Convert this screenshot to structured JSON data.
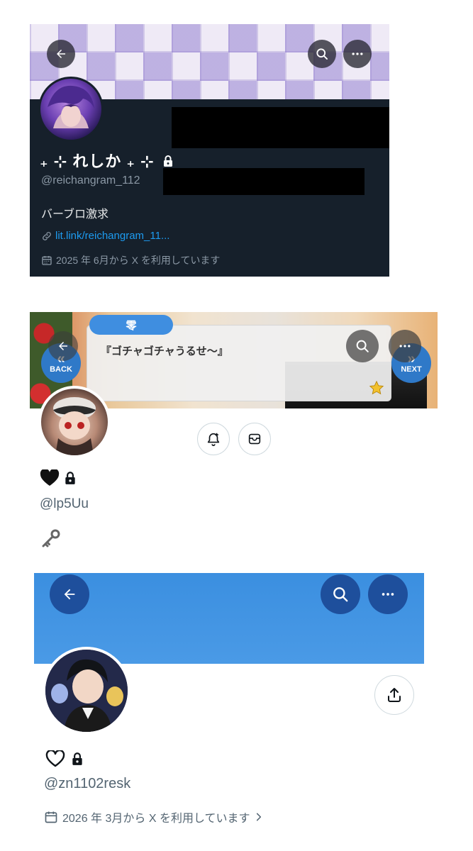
{
  "profile1": {
    "display_name": "₊ ⊹ れしか ₊ ⊹",
    "handle": "@reichangram_112",
    "bio": "バーブロ激求",
    "link": "lit.link/reichangram_11...",
    "joined": "2025 年 6月から X を利用しています",
    "icons": [
      "back-arrow-icon",
      "search-icon",
      "more-icon",
      "lock-icon",
      "link-icon",
      "calendar-icon"
    ]
  },
  "profile2": {
    "game_speaker": "零",
    "game_quote": "『ゴチャゴチャうるせ～』",
    "game_back_label": "BACK",
    "game_next_label": "NEXT",
    "handle": "@lp5Uu",
    "icons": [
      "back-arrow-icon",
      "search-icon",
      "more-icon",
      "bell-plus-icon",
      "mail-icon",
      "heart-filled-icon",
      "lock-icon",
      "key-icon",
      "star-icon"
    ]
  },
  "profile3": {
    "handle": "@zn1102resk",
    "joined": "2026 年 3月から X を利用しています",
    "icons": [
      "back-arrow-icon",
      "search-icon",
      "more-icon",
      "share-icon",
      "heart-outline-icon",
      "lock-icon",
      "calendar-icon",
      "chevron-right-icon"
    ]
  },
  "colors": {
    "dark_bg": "#16202b",
    "link_blue": "#1d9bf0",
    "muted_dark": "#8b98a5",
    "muted_light": "#536471",
    "banner_blue": "#3b8fe0",
    "game_blue": "#3f8ee0"
  }
}
